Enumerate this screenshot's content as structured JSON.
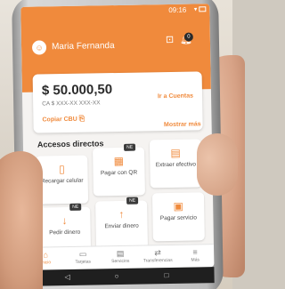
{
  "status_bar": {
    "time": "09:16"
  },
  "header": {
    "user_name": "Maria Fernanda",
    "help_icon": "help-chat-icon",
    "notifications_icon": "bell-icon",
    "notifications_count": "0"
  },
  "account_card": {
    "balance": "$ 50.000,50",
    "account_number": "CA $ XXX-XX XXX-XX",
    "account_link": "Ir a Cuentas",
    "copy_cbu": "Copiar CBU"
  },
  "shortcuts": {
    "title": "Accesos directos",
    "show_more": "Mostrar más",
    "items": [
      {
        "label": "Recargar celular",
        "icon": "phone-recharge-icon",
        "badge": ""
      },
      {
        "label": "Pagar con QR",
        "icon": "qr-code-icon",
        "badge": "NE"
      },
      {
        "label": "Extraer efectivo",
        "icon": "atm-icon",
        "badge": ""
      },
      {
        "label": "Pedir dinero",
        "icon": "arrow-down-icon",
        "badge": "NE"
      },
      {
        "label": "Enviar dinero",
        "icon": "arrow-up-icon",
        "badge": "NE"
      },
      {
        "label": "Pagar servicio",
        "icon": "bill-icon",
        "badge": ""
      }
    ]
  },
  "bottom_nav": {
    "items": [
      {
        "label": "Inicio",
        "icon": "home-icon"
      },
      {
        "label": "Tarjetas",
        "icon": "card-icon"
      },
      {
        "label": "Servicios",
        "icon": "receipt-icon"
      },
      {
        "label": "Transferencias",
        "icon": "transfer-icon"
      },
      {
        "label": "Más",
        "icon": "menu-icon"
      }
    ]
  },
  "colors": {
    "accent": "#f08a3c",
    "background": "#f5f3f1"
  }
}
